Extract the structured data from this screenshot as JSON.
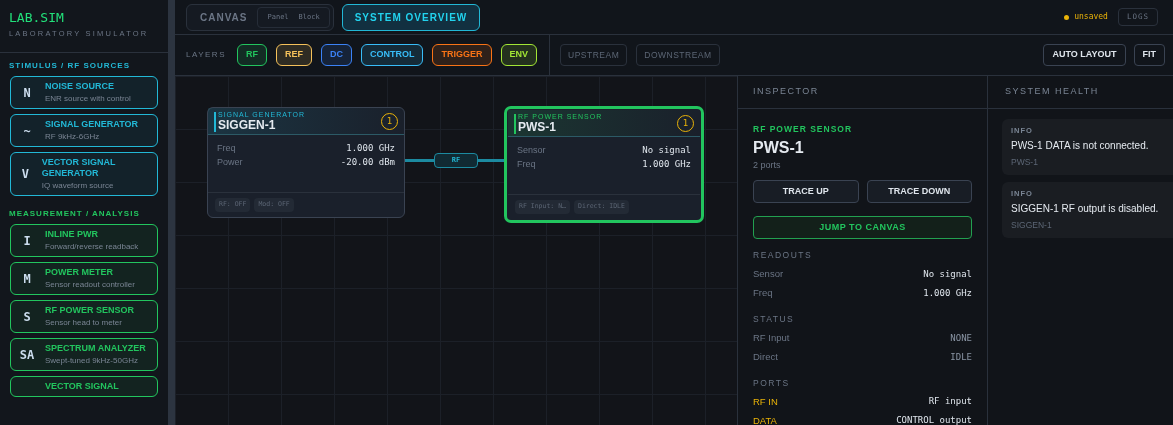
{
  "brand": {
    "title": "LAB.SIM",
    "subtitle": "LABORATORY SIMULATOR"
  },
  "sidebar": {
    "sections": [
      {
        "title": "STIMULUS / RF SOURCES",
        "color": "#22b8d6",
        "items": [
          {
            "icon": "N",
            "name": "NOISE SOURCE",
            "description": "ENR source with control"
          },
          {
            "icon": "~",
            "name": "SIGNAL GENERATOR",
            "description": "RF 9kHz-6GHz"
          },
          {
            "icon": "V",
            "name": "VECTOR SIGNAL GENERATOR",
            "description": "IQ waveform source"
          }
        ]
      },
      {
        "title": "MEASUREMENT / ANALYSIS",
        "color": "#22c55e",
        "items": [
          {
            "icon": "I",
            "name": "INLINE PWR",
            "description": "Forward/reverse readback"
          },
          {
            "icon": "M",
            "name": "POWER METER",
            "description": "Sensor readout controller"
          },
          {
            "icon": "S",
            "name": "RF POWER SENSOR",
            "description": "Sensor head to meter"
          },
          {
            "icon": "SA",
            "name": "SPECTRUM ANALYZER",
            "description": "Swept-tuned 9kHz-50GHz"
          },
          {
            "name": "VECTOR SIGNAL"
          }
        ]
      }
    ]
  },
  "tabs": [
    {
      "label": "CANVAS",
      "selected": false,
      "modes": [
        {
          "label": "Panel",
          "selected": false
        },
        {
          "label": "Block",
          "selected": false
        }
      ]
    },
    {
      "label": "SYSTEM OVERVIEW",
      "selected": true
    }
  ],
  "save_status": {
    "label": "unsaved",
    "saved": false
  },
  "logs_button": "LOGS",
  "layers": {
    "label": "LAYERS",
    "items": [
      {
        "label": "RF",
        "color": "#22c55e"
      },
      {
        "label": "REF",
        "color": "#f5c15a"
      },
      {
        "label": "DC",
        "color": "#3b82f6"
      },
      {
        "label": "CONTROL",
        "color": "#38bdf8"
      },
      {
        "label": "TRIGGER",
        "color": "#f97316"
      },
      {
        "label": "ENV",
        "color": "#a3e635"
      }
    ]
  },
  "trace_buttons": [
    {
      "label": "UPSTREAM",
      "disabled": true
    },
    {
      "label": "DOWNSTREAM",
      "disabled": true
    }
  ],
  "view_buttons": [
    "AUTO LAYOUT",
    "FIT"
  ],
  "canvas": {
    "nodes": [
      {
        "type": "SIGNAL GENERATOR",
        "name": "SIGGEN-1",
        "color": "#22b8d6",
        "selected": false,
        "badge": "1",
        "rows": [
          {
            "label": "Freq",
            "value": "1.000 GHz"
          },
          {
            "label": "Power",
            "value": "-20.00 dBm"
          }
        ],
        "chips": [
          "RF: OFF",
          "Mod: OFF"
        ]
      },
      {
        "type": "RF POWER SENSOR",
        "name": "PWS-1",
        "color": "#22c55e",
        "selected": true,
        "badge": "1",
        "rows": [
          {
            "label": "Sensor",
            "value": "No signal"
          },
          {
            "label": "Freq",
            "value": "1.000 GHz"
          }
        ],
        "chips": [
          "RF Input: N…",
          "Direct: IDLE"
        ]
      }
    ],
    "edges": [
      {
        "label": "RF"
      }
    ]
  },
  "inspector": {
    "title": "INSPECTOR",
    "type": "RF POWER SENSOR",
    "name": "PWS-1",
    "ports_count": "2 ports",
    "buttons": [
      "TRACE UP",
      "TRACE DOWN"
    ],
    "jump_button": "JUMP TO CANVAS",
    "sections": [
      {
        "title": "READOUTS",
        "kind": "readout",
        "rows": [
          {
            "label": "Sensor",
            "value": "No signal"
          },
          {
            "label": "Freq",
            "value": "1.000 GHz"
          }
        ]
      },
      {
        "title": "STATUS",
        "kind": "status",
        "rows": [
          {
            "label": "RF Input",
            "value": "NONE"
          },
          {
            "label": "Direct",
            "value": "IDLE"
          }
        ]
      },
      {
        "title": "PORTS",
        "kind": "port",
        "rows": [
          {
            "label": "RF IN",
            "value": "RF input"
          },
          {
            "label": "DATA",
            "value": "CONTROL output"
          }
        ]
      }
    ]
  },
  "system_health": {
    "title": "SYSTEM HEALTH",
    "items": [
      {
        "level": "INFO",
        "message": "PWS-1 DATA is not connected.",
        "source": "PWS-1"
      },
      {
        "level": "INFO",
        "message": "SIGGEN-1 RF output is disabled.",
        "source": "SIGGEN-1"
      }
    ]
  }
}
